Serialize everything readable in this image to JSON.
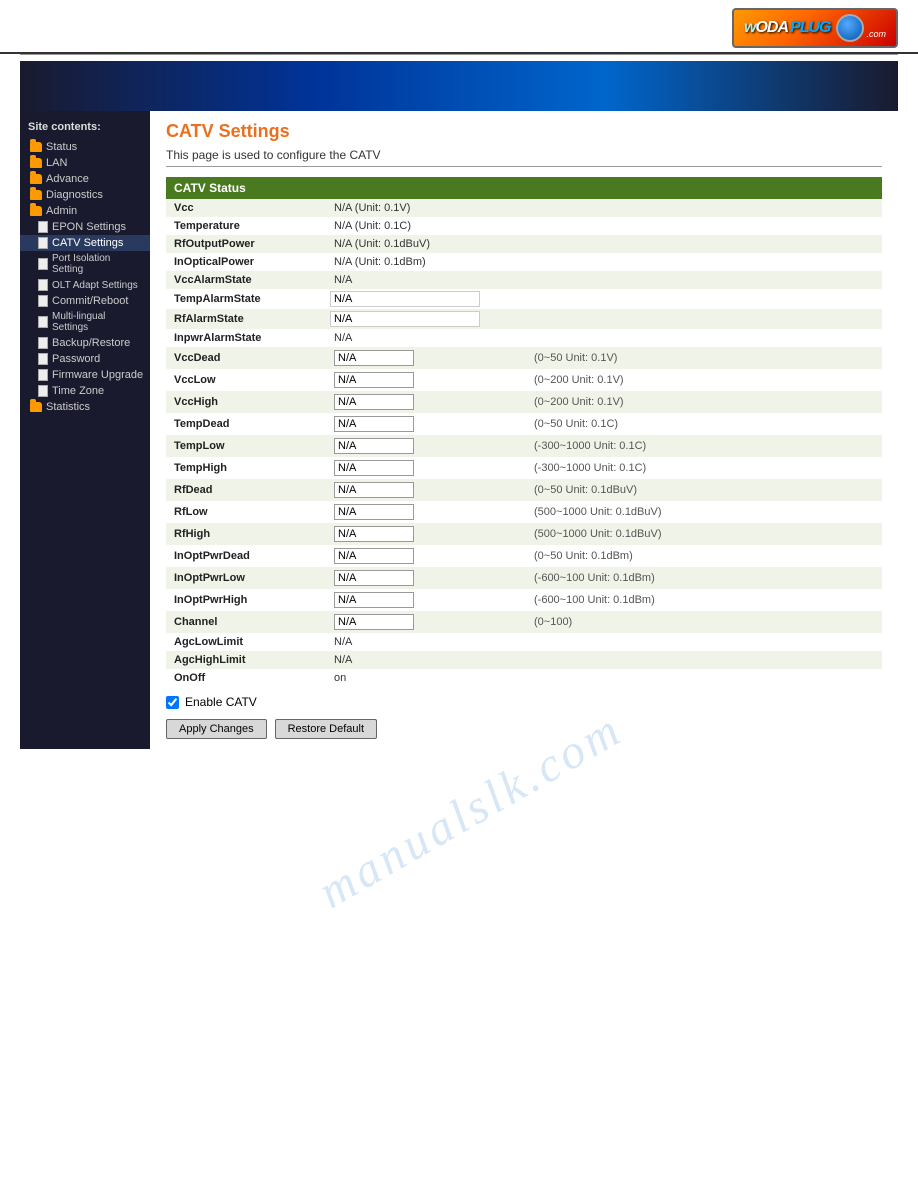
{
  "header": {
    "logo_woda": "woda",
    "logo_plug": "PLUG",
    "logo_com": ".com"
  },
  "sidebar": {
    "title": "Site contents:",
    "items": [
      {
        "label": "Status",
        "type": "folder",
        "level": 0
      },
      {
        "label": "LAN",
        "type": "folder",
        "level": 0
      },
      {
        "label": "Advance",
        "type": "folder",
        "level": 0
      },
      {
        "label": "Diagnostics",
        "type": "folder",
        "level": 0
      },
      {
        "label": "Admin",
        "type": "folder",
        "level": 0
      },
      {
        "label": "EPON Settings",
        "type": "doc",
        "level": 1
      },
      {
        "label": "CATV Settings",
        "type": "doc",
        "level": 1
      },
      {
        "label": "Port Isolation Setting",
        "type": "doc",
        "level": 1
      },
      {
        "label": "OLT Adapt Settings",
        "type": "doc",
        "level": 1
      },
      {
        "label": "Commit/Reboot",
        "type": "doc",
        "level": 1
      },
      {
        "label": "Multi-lingual Settings",
        "type": "doc",
        "level": 1
      },
      {
        "label": "Backup/Restore",
        "type": "doc",
        "level": 1
      },
      {
        "label": "Password",
        "type": "doc",
        "level": 1
      },
      {
        "label": "Firmware Upgrade",
        "type": "doc",
        "level": 1
      },
      {
        "label": "Time Zone",
        "type": "doc",
        "level": 1
      },
      {
        "label": "Statistics",
        "type": "folder",
        "level": 0
      }
    ]
  },
  "content": {
    "page_title": "CATV Settings",
    "page_desc": "This page is used to configure the CATV",
    "catv_status_header": "CATV Status",
    "rows": [
      {
        "label": "Vcc",
        "value": "N/A (Unit: 0.1V)",
        "hint": "",
        "type": "status"
      },
      {
        "label": "Temperature",
        "value": "N/A (Unit: 0.1C)",
        "hint": "",
        "type": "status"
      },
      {
        "label": "RfOutputPower",
        "value": "N/A (Unit: 0.1dBuV)",
        "hint": "",
        "type": "status"
      },
      {
        "label": "InOpticalPower",
        "value": "N/A (Unit: 0.1dBm)",
        "hint": "",
        "type": "status"
      },
      {
        "label": "VccAlarmState",
        "value": "N/A",
        "hint": "",
        "type": "status"
      },
      {
        "label": "TempAlarmState",
        "value": "N/A",
        "hint": "",
        "type": "alarm"
      },
      {
        "label": "RfAlarmState",
        "value": "N/A",
        "hint": "",
        "type": "alarm"
      },
      {
        "label": "InpwrAlarmState",
        "value": "N/A",
        "hint": "",
        "type": "status"
      },
      {
        "label": "VccDead",
        "value": "N/A",
        "hint": "(0~50 Unit: 0.1V)",
        "type": "input"
      },
      {
        "label": "VccLow",
        "value": "N/A",
        "hint": "(0~200 Unit: 0.1V)",
        "type": "input"
      },
      {
        "label": "VccHigh",
        "value": "N/A",
        "hint": "(0~200 Unit: 0.1V)",
        "type": "input"
      },
      {
        "label": "TempDead",
        "value": "N/A",
        "hint": "(0~50 Unit: 0.1C)",
        "type": "input"
      },
      {
        "label": "TempLow",
        "value": "N/A",
        "hint": "(-300~1000 Unit: 0.1C)",
        "type": "input"
      },
      {
        "label": "TempHigh",
        "value": "N/A",
        "hint": "(-300~1000 Unit: 0.1C)",
        "type": "input"
      },
      {
        "label": "RfDead",
        "value": "N/A",
        "hint": "(0~50 Unit: 0.1dBuV)",
        "type": "input"
      },
      {
        "label": "RfLow",
        "value": "N/A",
        "hint": "(500~1000 Unit: 0.1dBuV)",
        "type": "input"
      },
      {
        "label": "RfHigh",
        "value": "N/A",
        "hint": "(500~1000 Unit: 0.1dBuV)",
        "type": "input"
      },
      {
        "label": "InOptPwrDead",
        "value": "N/A",
        "hint": "(0~50 Unit: 0.1dBm)",
        "type": "input"
      },
      {
        "label": "InOptPwrLow",
        "value": "N/A",
        "hint": "(-600~100 Unit: 0.1dBm)",
        "type": "input"
      },
      {
        "label": "InOptPwrHigh",
        "value": "N/A",
        "hint": "(-600~100 Unit: 0.1dBm)",
        "type": "input"
      },
      {
        "label": "Channel",
        "value": "N/A",
        "hint": "(0~100)",
        "type": "input"
      },
      {
        "label": "AgcLowLimit",
        "value": "N/A",
        "hint": "",
        "type": "input_nohint"
      },
      {
        "label": "AgcHighLimit",
        "value": "N/A",
        "hint": "",
        "type": "input_nohint"
      },
      {
        "label": "OnOff",
        "value": "on",
        "hint": "",
        "type": "status"
      }
    ],
    "enable_catv_label": "Enable CATV",
    "apply_button": "Apply Changes",
    "restore_button": "Restore Default"
  },
  "watermark": "manualslk.com"
}
